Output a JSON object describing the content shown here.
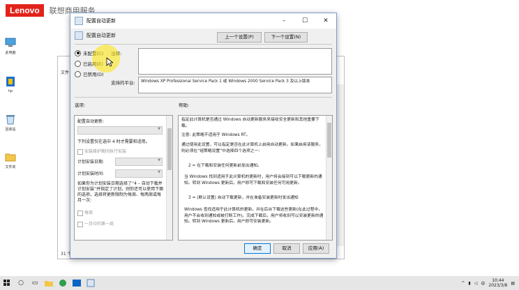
{
  "brand": {
    "logo": "Lenovo",
    "subtitle": "联想商用服务"
  },
  "desktop": {
    "icons": [
      "此电脑",
      "hp",
      "回收站",
      "文件夹"
    ]
  },
  "explorer": {
    "menu": "文件",
    "status": "31 个"
  },
  "dialog": {
    "title": "配置自动更新",
    "subtitle": "配置自动更新",
    "prev_button": "上一个设置(P)",
    "next_button": "下一个设置(N)",
    "radio_not_configured": "未配置(C)",
    "radio_enabled": "已启用(E)",
    "radio_disabled": "已禁用(D)",
    "comment_label": "注释:",
    "supported_label": "支持的平台:",
    "supported_text": "Windows XP Professional Service Pack 1 或 Windows 2000 Service Pack 3 及以上版本",
    "options_header": "选项:",
    "help_header": "帮助:",
    "options": {
      "configure_label": "配置自动更新:",
      "line1": "下列设置仅在选中 4 时才需要和适用。",
      "checkbox_maint": "安装维护期间执行安装",
      "schedule_day": "计划安装日期:",
      "schedule_time": "计划安装时间:",
      "para": "如果你为计划安装日期选择了“4 – 自动下载并计划安装”并指定了计划，则你还可以使用下面的选项，选择将更新限制为每周、每两周或每月一次:",
      "weekly": "每周",
      "first_week": "一月中的第一周"
    },
    "help": {
      "p1": "指定此计算机是否通过 Windows 自动更新服务来接收安全更新和其他重要下载。",
      "p2": "注意: 此策略不适用于 Windows RT。",
      "p3": "通过使用此设置，可以指定是否在此计算机上启用自动更新。如果启用该服务，则必须在“组策略设置”中选择四个选项之一:",
      "p4": "2 = 在下载和安装任何更新前发出通知。",
      "p5": "当 Windows 找到适用于此计算机的更新时，用户将会接到可以下载更新的通知。转到 Windows 更新后，用户即可下载和安装任何可用更新。",
      "p6": "3 = (默认设置) 自动下载更新，并在准备安装更新时发出通知",
      "p7": "Windows 查找适用于此计算机的更新，并在后台下载这些更新(在此过程中，用户不会收到通知或被打断工作)。完成下载后，用户将收到可以安装更新的通知。转到 Windows 更新后，用户即可安装更新。"
    },
    "ok_button": "确定",
    "cancel_button": "取消",
    "apply_button": "应用(A)"
  },
  "taskbar": {
    "time": "10:44",
    "date": "2023/3/8"
  },
  "colors": {
    "lenovo_red": "#e2231a",
    "cursor_highlight": "#ffe600"
  }
}
